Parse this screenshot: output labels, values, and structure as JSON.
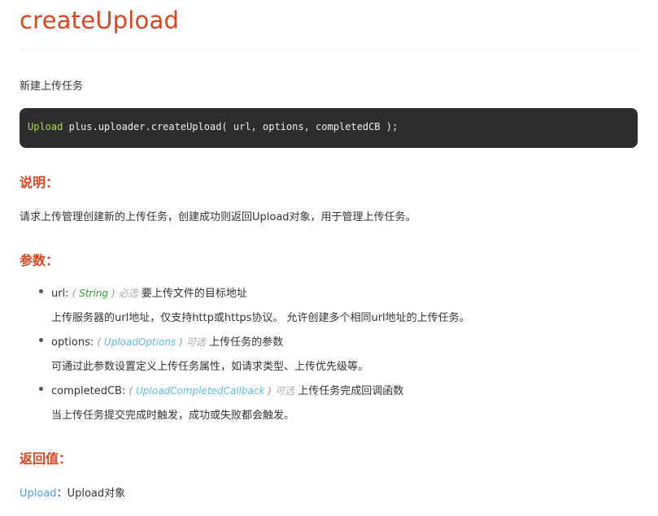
{
  "title": "createUpload",
  "description": "新建上传任务",
  "code": {
    "return_type": "Upload",
    "signature": " plus.uploader.createUpload( url, options, completedCB );"
  },
  "sections": {
    "explain_heading": "说明：",
    "explain_text": "请求上传管理创建新的上传任务，创建成功则返回Upload对象，用于管理上传任务。",
    "params_heading": "参数：",
    "return_heading": "返回值："
  },
  "params": [
    {
      "name": "url:",
      "open": "( ",
      "type": "String",
      "close": " )",
      "qualifier": "必选",
      "summary": "要上传文件的目标地址",
      "detail": "上传服务器的url地址，仅支持http或https协议。 允许创建多个相同url地址的上传任务。"
    },
    {
      "name": "options:",
      "open": "( ",
      "type": "UploadOptions",
      "close": " )",
      "qualifier": "可选",
      "summary": "上传任务的参数",
      "detail": "可通过此参数设置定义上传任务属性，如请求类型、上传优先级等。"
    },
    {
      "name": "completedCB:",
      "open": "( ",
      "type": "UploadCompletedCallback",
      "close": " )",
      "qualifier": "可选",
      "summary": "上传任务完成回调函数",
      "detail": "当上传任务提交完成时触发，成功或失败都会触发。"
    }
  ],
  "returns": {
    "type": "Upload",
    "sep": "：",
    "text": "Upload对象"
  }
}
